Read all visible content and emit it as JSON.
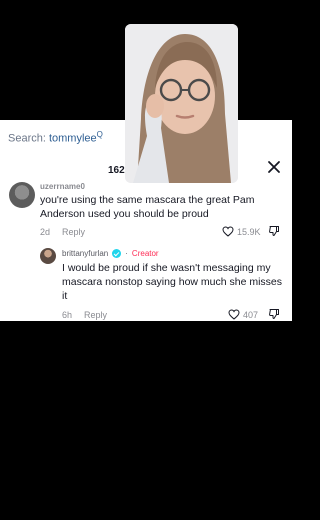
{
  "search": {
    "label": "Search: ",
    "term": "tommylee",
    "suffix": "Q"
  },
  "comments_count": "162",
  "comment": {
    "username": "uzerrname0",
    "text": "you're using the same mascara the great Pam Anderson used you should be proud",
    "time": "2d",
    "reply_label": "Reply",
    "likes": "15.9K"
  },
  "reply": {
    "username": "brittanyfurlan",
    "badge": "Creator",
    "separator": "·",
    "text": "I would be proud if she wasn't messaging my mascara nonstop saying how much she misses it",
    "time": "6h",
    "reply_label": "Reply",
    "likes": "407"
  },
  "colors": {
    "accent": "#fe2c55",
    "verified": "#20d5ec",
    "link": "#2f5f93"
  },
  "icons": [
    "close-icon",
    "heart-icon",
    "dislike-icon",
    "verified-icon",
    "search-icon"
  ]
}
